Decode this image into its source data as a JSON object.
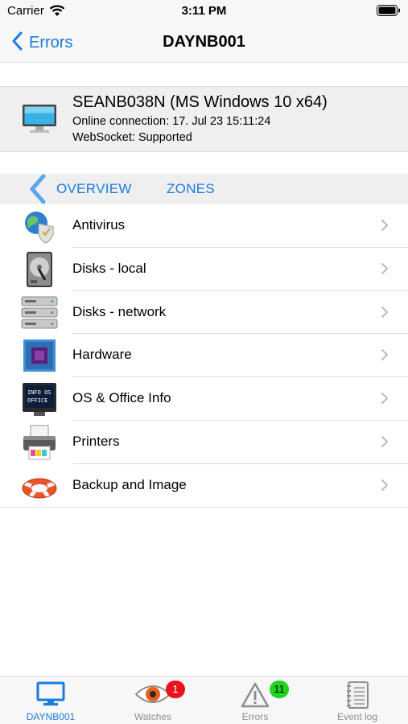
{
  "status_bar": {
    "carrier": "Carrier",
    "time": "3:11 PM"
  },
  "nav": {
    "back_label": "Errors",
    "title": "DAYNB001"
  },
  "device": {
    "name": "SEANB038N (MS Windows 10 x64)",
    "connection": "Online connection: 17. Jul 23 15:11:24",
    "websocket": "WebSocket: Supported",
    "icon": "monitor-icon"
  },
  "tabs": [
    {
      "label": "OVERVIEW"
    },
    {
      "label": "ZONES"
    }
  ],
  "list": [
    {
      "label": "Antivirus",
      "icon": "antivirus-icon"
    },
    {
      "label": "Disks - local",
      "icon": "hard-disk-icon"
    },
    {
      "label": "Disks - network",
      "icon": "network-disks-icon"
    },
    {
      "label": "Hardware",
      "icon": "chip-icon"
    },
    {
      "label": "OS & Office Info",
      "icon": "os-info-icon"
    },
    {
      "label": "Printers",
      "icon": "printer-icon"
    },
    {
      "label": "Backup and Image",
      "icon": "lifebuoy-icon"
    }
  ],
  "tab_bar": [
    {
      "label": "DAYNB001",
      "icon": "monitor-icon",
      "active": true
    },
    {
      "label": "Watches",
      "icon": "eye-icon",
      "badge": "1"
    },
    {
      "label": "Errors",
      "icon": "warning-icon",
      "badge": "11"
    },
    {
      "label": "Event log",
      "icon": "notebook-icon"
    }
  ],
  "colors": {
    "accent": "#1a7be0",
    "badge_red": "#e8141c",
    "badge_green": "#21d321"
  }
}
